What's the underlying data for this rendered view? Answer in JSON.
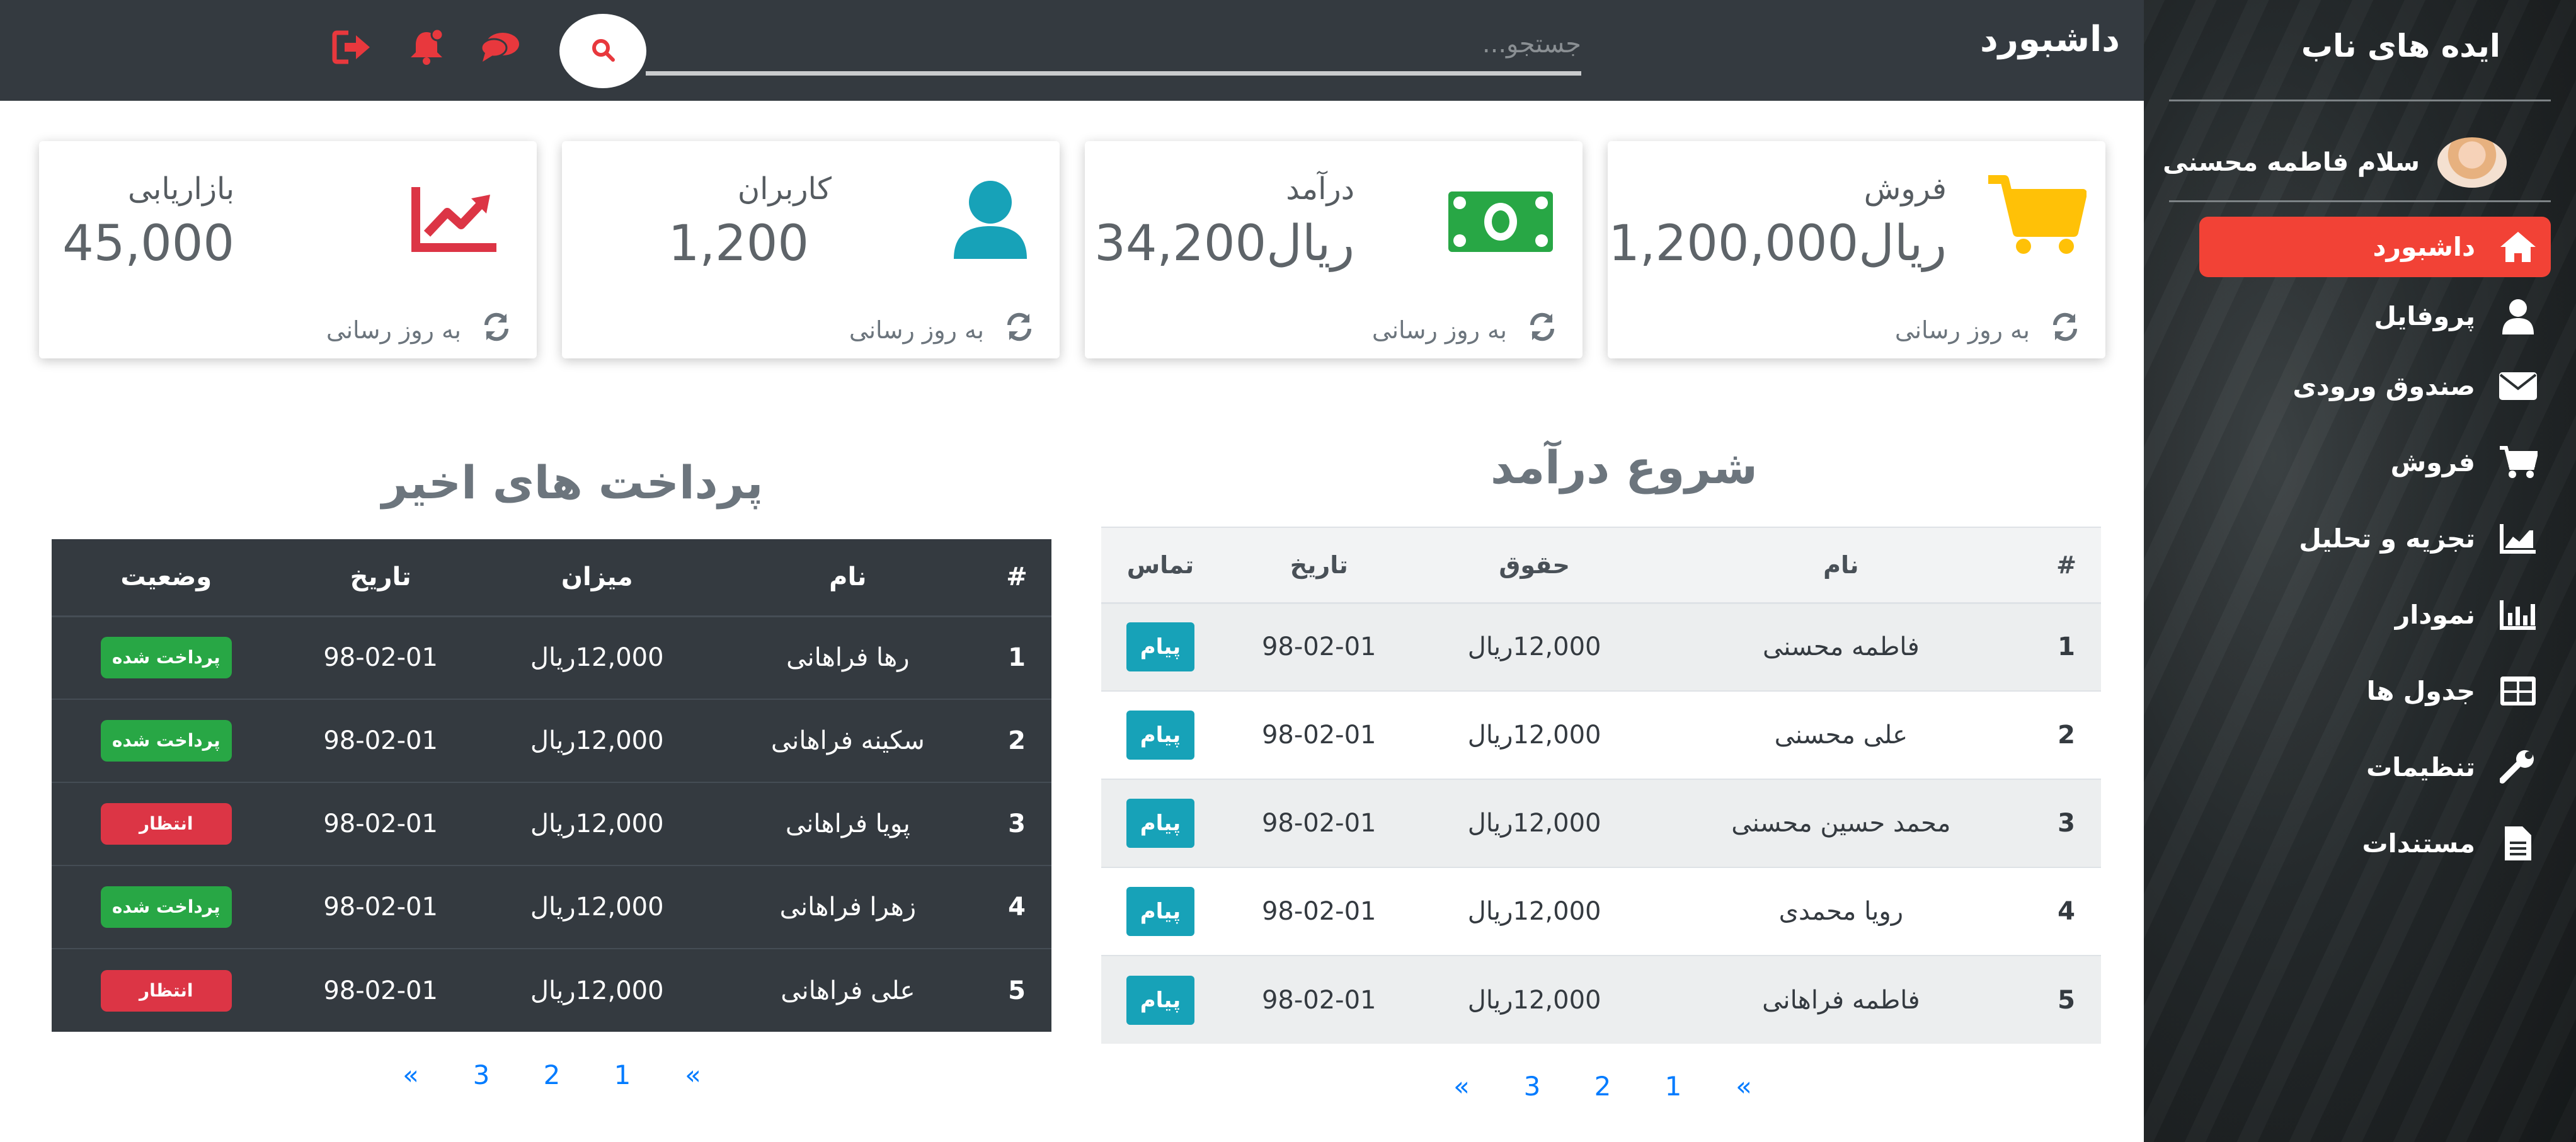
{
  "sidebar": {
    "brand": "ایده های ناب",
    "user_greeting": "سلام فاطمه محسنی",
    "items": [
      {
        "label": "داشبورد",
        "icon": "home-icon",
        "active": true
      },
      {
        "label": "پروفایل",
        "icon": "user-icon"
      },
      {
        "label": "صندوق ورودی",
        "icon": "envelope-icon"
      },
      {
        "label": "فروش",
        "icon": "cart-icon"
      },
      {
        "label": "تجزیه و تحلیل",
        "icon": "chart-area-icon"
      },
      {
        "label": "نمودار",
        "icon": "bar-chart-icon"
      },
      {
        "label": "جدول ها",
        "icon": "table-icon"
      },
      {
        "label": "تنظیمات",
        "icon": "wrench-icon"
      },
      {
        "label": "مستندات",
        "icon": "file-icon"
      }
    ]
  },
  "header": {
    "title": "داشبورد",
    "search_placeholder": "جستجو...",
    "icons": [
      "sign-out-icon",
      "bell-icon",
      "comments-icon"
    ]
  },
  "cards": [
    {
      "title": "فروش",
      "value": "1,200,000ریال",
      "footer": "به روز رسانی",
      "icon": "cart-icon",
      "color": "#ffc107"
    },
    {
      "title": "درآمد",
      "value": "34,200ریال",
      "footer": "به روز رسانی",
      "icon": "money-icon",
      "color": "#28a745"
    },
    {
      "title": "کاربران",
      "value": "1,200",
      "footer": "به روز رسانی",
      "icon": "user-icon",
      "color": "#17a2b8"
    },
    {
      "title": "بازاریابی",
      "value": "45,000",
      "footer": "به روز رسانی",
      "icon": "chart-line-icon",
      "color": "#dc3545"
    }
  ],
  "income": {
    "title": "شروع درآمد",
    "headers": [
      "#",
      "نام",
      "حقوق",
      "تاریخ",
      "تماس"
    ],
    "rows": [
      {
        "num": "1",
        "name": "فاطمه محسنی",
        "salary": "12,000ریال",
        "date": "98-02-01",
        "action": "پیام"
      },
      {
        "num": "2",
        "name": "علی محسنی",
        "salary": "12,000ریال",
        "date": "98-02-01",
        "action": "پیام"
      },
      {
        "num": "3",
        "name": "محمد حسین محسنی",
        "salary": "12,000ریال",
        "date": "98-02-01",
        "action": "پیام"
      },
      {
        "num": "4",
        "name": "رویا محمدی",
        "salary": "12,000ریال",
        "date": "98-02-01",
        "action": "پیام"
      },
      {
        "num": "5",
        "name": "فاطمه فراهانی",
        "salary": "12,000ریال",
        "date": "98-02-01",
        "action": "پیام"
      }
    ],
    "pagination": [
      "«",
      "3",
      "2",
      "1",
      "«"
    ]
  },
  "payments": {
    "title": "پرداخت های اخیر",
    "headers": [
      "#",
      "نام",
      "میزان",
      "تاریخ",
      "وضعیت"
    ],
    "rows": [
      {
        "num": "1",
        "name": "رها فراهانی",
        "amount": "12,000ریال",
        "date": "98-02-01",
        "status": "پرداخت شده",
        "status_type": "paid"
      },
      {
        "num": "2",
        "name": "سکینه فراهانی",
        "amount": "12,000ریال",
        "date": "98-02-01",
        "status": "پرداخت شده",
        "status_type": "paid"
      },
      {
        "num": "3",
        "name": "پویا فراهانی",
        "amount": "12,000ریال",
        "date": "98-02-01",
        "status": "انتظار",
        "status_type": "wait"
      },
      {
        "num": "4",
        "name": "زهرا فراهانی",
        "amount": "12,000ریال",
        "date": "98-02-01",
        "status": "پرداخت شده",
        "status_type": "paid"
      },
      {
        "num": "5",
        "name": "علی فراهانی",
        "amount": "12,000ریال",
        "date": "98-02-01",
        "status": "انتظار",
        "status_type": "wait"
      }
    ],
    "pagination": [
      "«",
      "3",
      "2",
      "1",
      "«"
    ]
  },
  "colors": {
    "sidebar_active": "#f24236",
    "header_bg": "#343a40",
    "msg_button": "#17a2b8",
    "paid": "#28a745",
    "waiting": "#dc3545",
    "link": "#007bff"
  }
}
